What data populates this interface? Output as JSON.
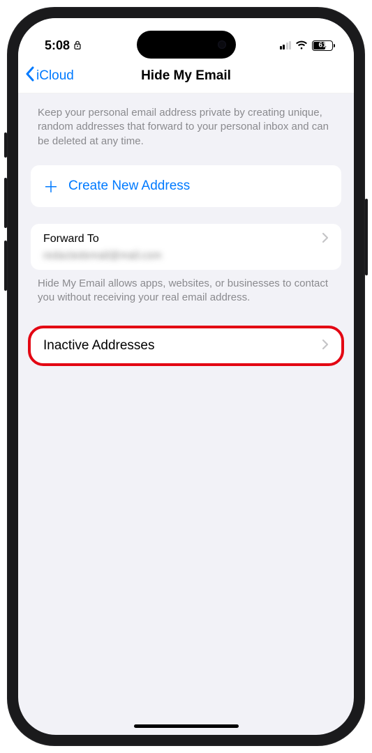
{
  "status": {
    "time": "5:08",
    "battery": "61"
  },
  "nav": {
    "back": "iCloud",
    "title": "Hide My Email"
  },
  "description": "Keep your personal email address private by creating unique, random addresses that forward to your personal inbox and can be deleted at any time.",
  "create_label": "Create New Address",
  "forward": {
    "label": "Forward To",
    "value": "redactedemail@mail.com",
    "footer": "Hide My Email allows apps, websites, or businesses to contact you without receiving your real email address."
  },
  "inactive_label": "Inactive Addresses"
}
